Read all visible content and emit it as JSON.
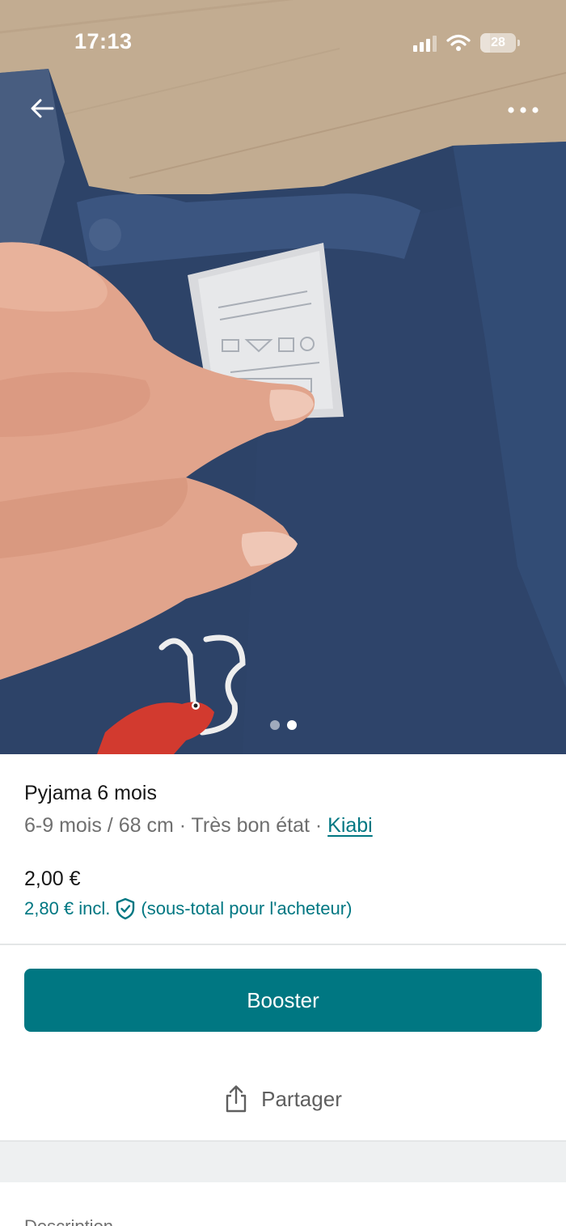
{
  "status_bar": {
    "time": "17:13",
    "battery": "28",
    "battery_level": 0.28
  },
  "photo": {
    "icons": {
      "back": "arrow-left-icon",
      "more": "more-horizontal-icon"
    },
    "dots_total": 2,
    "active_dot": 2
  },
  "item": {
    "title": "Pyjama 6 mois",
    "size": "6-9 mois / 68 cm",
    "separator": " · ",
    "condition": "Très bon état",
    "brand": "Kiabi",
    "price": "2,00 €",
    "price_incl": "2,80 € incl.",
    "price_incl_note": "(sous-total pour l'acheteur)"
  },
  "actions": {
    "booster_label": "Booster",
    "share_label": "Partager",
    "share_icon": "share-upload-icon"
  },
  "description": {
    "heading": "Description"
  },
  "colors": {
    "accent": "#007782",
    "text": "#171717",
    "muted": "#6f6f6f",
    "divider": "#e4e6e7",
    "band": "#eef0f1"
  }
}
